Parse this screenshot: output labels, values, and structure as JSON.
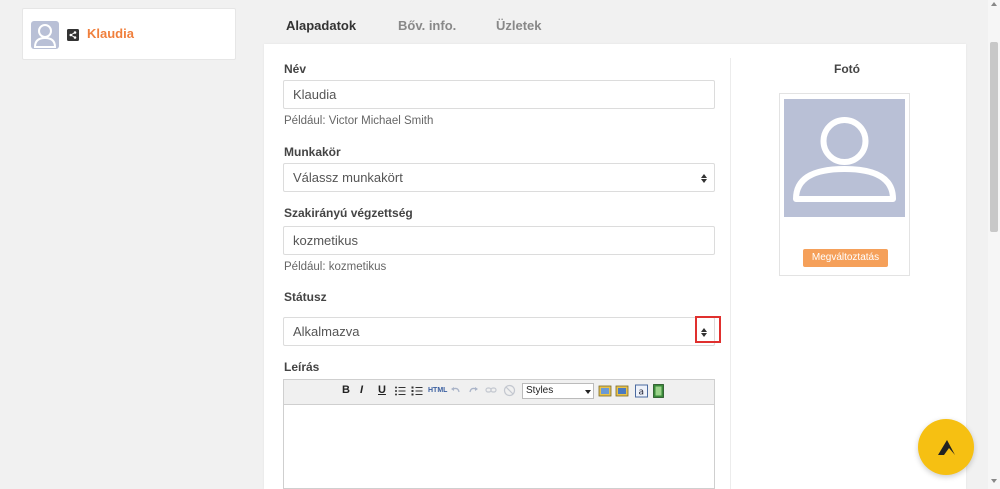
{
  "profile": {
    "name": "Klaudia"
  },
  "tabs": [
    {
      "label": "Alapadatok",
      "active": true
    },
    {
      "label": "Bőv. info.",
      "active": false
    },
    {
      "label": "Üzletek",
      "active": false
    }
  ],
  "form": {
    "name": {
      "label": "Név",
      "value": "Klaudia",
      "hint": "Például: Victor Michael Smith"
    },
    "job": {
      "label": "Munkakör",
      "value": "Válassz munkakört"
    },
    "qualification": {
      "label": "Szakirányú végzettség",
      "value": "kozmetikus",
      "hint": "Például: kozmetikus"
    },
    "status": {
      "label": "Státusz",
      "value": "Alkalmazva"
    },
    "description": {
      "label": "Leírás",
      "toolbar": {
        "bold": "B",
        "italic": "I",
        "underline": "U",
        "html": "HTML",
        "styles": "Styles"
      }
    }
  },
  "photo": {
    "title": "Fotó",
    "change_label": "Megváltoztatás"
  },
  "colors": {
    "accent": "#f07f3c",
    "fab": "#f6c012",
    "highlight": "#e0302e"
  },
  "icons": [
    "share-icon",
    "user-avatar-icon",
    "select-arrows-icon",
    "logo-icon"
  ]
}
